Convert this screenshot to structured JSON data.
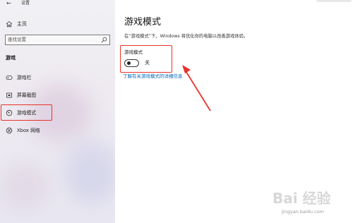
{
  "window": {
    "title": "设置",
    "back_glyph": "←"
  },
  "sidebar": {
    "home_label": "主页",
    "search_placeholder": "查找设置",
    "section_title": "游戏",
    "items": [
      {
        "label": "游戏栏",
        "icon": "game-bar-icon",
        "selected": false
      },
      {
        "label": "屏幕截图",
        "icon": "capture-icon",
        "selected": false
      },
      {
        "label": "游戏模式",
        "icon": "game-mode-icon",
        "selected": true
      },
      {
        "label": "Xbox 网络",
        "icon": "xbox-icon",
        "selected": false
      }
    ]
  },
  "main": {
    "title": "游戏模式",
    "description": "在“游戏模式”下，Windows 将优化你的电脑以改善游戏体验。",
    "toggle": {
      "label": "游戏模式",
      "state_label": "关",
      "on": false
    },
    "link": "了解有关游戏模式的详细信息"
  },
  "watermark": {
    "text": "Bai 经验",
    "url": "jingyan.baidu.com"
  },
  "colors": {
    "accent": "#0078d7",
    "highlight_red": "#e8322a",
    "link": "#0066b4"
  }
}
